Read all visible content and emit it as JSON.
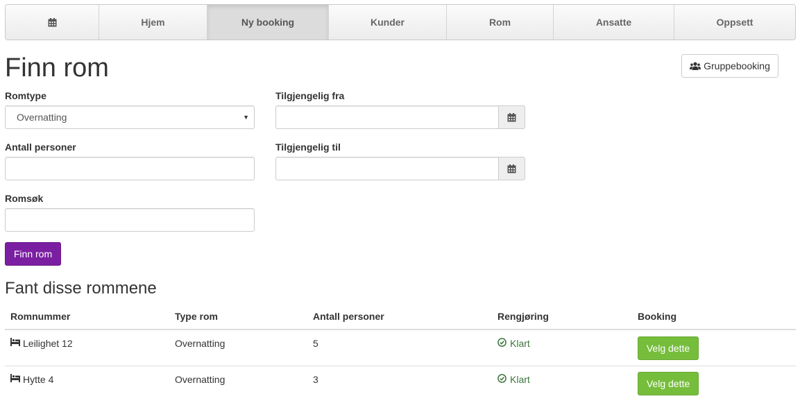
{
  "nav": {
    "items": [
      {
        "label": "",
        "icon": "calendar-icon"
      },
      {
        "label": "Hjem"
      },
      {
        "label": "Ny booking",
        "active": true
      },
      {
        "label": "Kunder"
      },
      {
        "label": "Rom"
      },
      {
        "label": "Ansatte"
      },
      {
        "label": "Oppsett"
      }
    ]
  },
  "page": {
    "title": "Finn rom",
    "group_booking_label": "Gruppebooking"
  },
  "form": {
    "room_type_label": "Romtype",
    "room_type_value": "Overnatting",
    "available_from_label": "Tilgjengelig fra",
    "available_from_value": "",
    "persons_label": "Antall personer",
    "persons_value": "",
    "available_to_label": "Tilgjengelig til",
    "available_to_value": "",
    "room_search_label": "Romsøk",
    "room_search_value": "",
    "submit_label": "Finn rom"
  },
  "results": {
    "title": "Fant disse rommene",
    "columns": [
      "Romnummer",
      "Type rom",
      "Antall personer",
      "Rengjøring",
      "Booking"
    ],
    "rows": [
      {
        "room": "Leilighet 12",
        "type": "Overnatting",
        "persons": "5",
        "cleaning": "Klart",
        "action": "Velg dette"
      },
      {
        "room": "Hytte 4",
        "type": "Overnatting",
        "persons": "3",
        "cleaning": "Klart",
        "action": "Velg dette"
      }
    ]
  },
  "colors": {
    "primary_button": "#7b1fa2",
    "success_button": "#76bd3c",
    "status_ok": "#3c763d"
  }
}
